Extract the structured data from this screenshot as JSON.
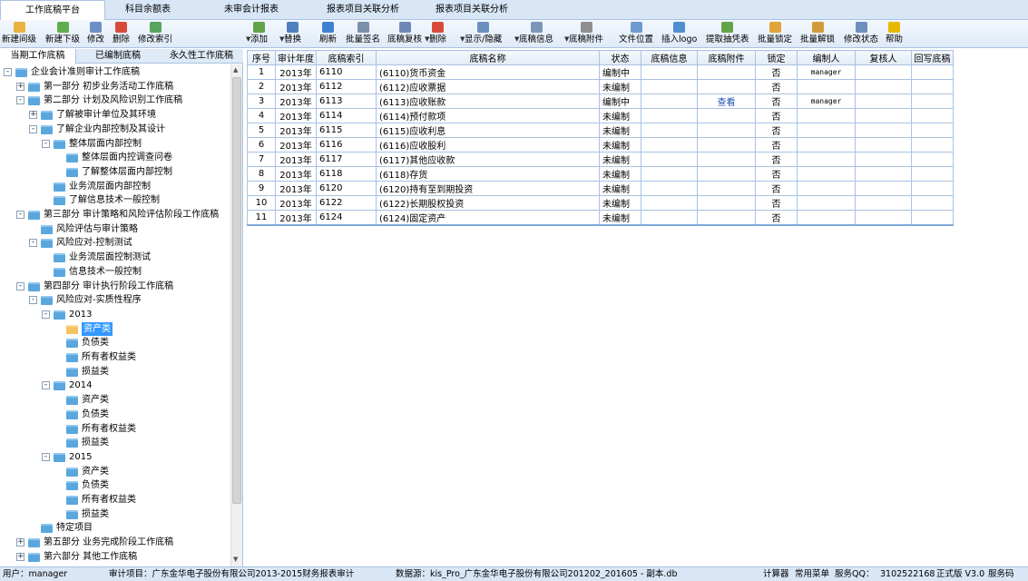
{
  "tabs": [
    "工作底稿平台",
    "科目余额表",
    "未审会计报表",
    "报表项目关联分析",
    "报表项目关联分析"
  ],
  "toolbar_left": [
    {
      "label": "新建间级",
      "icon": "folder-new-icon",
      "color": "#e9b33f"
    },
    {
      "label": "新建下级",
      "icon": "folder-child-icon",
      "color": "#5fae4e"
    },
    {
      "label": "修改",
      "icon": "edit-icon",
      "color": "#6d8fc4"
    },
    {
      "label": "删除",
      "icon": "delete-icon",
      "color": "#d84b3c"
    },
    {
      "label": "修改索引",
      "icon": "index-edit-icon",
      "color": "#55a55f"
    }
  ],
  "toolbar_right": [
    {
      "label": "添加",
      "icon": "add-icon",
      "color": "#62a347",
      "drop": true
    },
    {
      "label": "替换",
      "icon": "replace-icon",
      "color": "#4f7fbf",
      "drop": true
    },
    {
      "label": "刷新",
      "icon": "refresh-icon",
      "color": "#3f7fcf"
    },
    {
      "label": "批量签名",
      "icon": "batch-sign-icon",
      "color": "#7b8faa"
    },
    {
      "label": "底稿复核",
      "icon": "review-icon",
      "color": "#6e88b5"
    },
    {
      "label": "删除",
      "icon": "delete-icon",
      "color": "#d84b3c",
      "drop": true
    },
    {
      "label": "显示/隐藏",
      "icon": "show-hide-icon",
      "color": "#6b8fbf",
      "drop": true
    },
    {
      "label": "底稿信息",
      "icon": "info-icon",
      "color": "#7c96b8",
      "drop": true
    },
    {
      "label": "底稿附件",
      "icon": "attachment-icon",
      "color": "#8f8f8f",
      "drop": true
    },
    {
      "label": "文件位置",
      "icon": "file-location-icon",
      "color": "#6f9ad0"
    },
    {
      "label": "插入logo",
      "icon": "insert-logo-icon",
      "color": "#4f8fcf"
    },
    {
      "label": "提取抽凭表",
      "icon": "extract-icon",
      "color": "#62a347"
    },
    {
      "label": "批量锁定",
      "icon": "lock-icon",
      "color": "#e0a43a"
    },
    {
      "label": "批量解锁",
      "icon": "unlock-icon",
      "color": "#d39a3a"
    },
    {
      "label": "修改状态",
      "icon": "status-icon",
      "color": "#6f8fbf"
    },
    {
      "label": "帮助",
      "icon": "help-icon",
      "color": "#e6b800"
    }
  ],
  "left_tabs": [
    "当期工作底稿",
    "已编制底稿",
    "永久性工作底稿"
  ],
  "tree": [
    {
      "label": "企业会计准则审计工作底稿",
      "level": 0,
      "exp": "-"
    },
    {
      "label": "第一部分 初步业务活动工作底稿",
      "level": 1,
      "exp": "+"
    },
    {
      "label": "第二部分 计划及风险识别工作底稿",
      "level": 1,
      "exp": "-"
    },
    {
      "label": "了解被审计单位及其环境",
      "level": 2,
      "exp": "+"
    },
    {
      "label": "了解企业内部控制及其设计",
      "level": 2,
      "exp": "-"
    },
    {
      "label": "整体层面内部控制",
      "level": 3,
      "exp": "-"
    },
    {
      "label": "整体层面内控调查问卷",
      "level": 4,
      "exp": ""
    },
    {
      "label": "了解整体层面内部控制",
      "level": 4,
      "exp": ""
    },
    {
      "label": "业务流层面内部控制",
      "level": 3,
      "exp": ""
    },
    {
      "label": "了解信息技术一般控制",
      "level": 3,
      "exp": ""
    },
    {
      "label": "第三部分 审计策略和风险评估阶段工作底稿",
      "level": 1,
      "exp": "-"
    },
    {
      "label": "风险评估与审计策略",
      "level": 2,
      "exp": ""
    },
    {
      "label": "风险应对-控制测试",
      "level": 2,
      "exp": "-"
    },
    {
      "label": "业务流层面控制测试",
      "level": 3,
      "exp": ""
    },
    {
      "label": "信息技术一般控制",
      "level": 3,
      "exp": ""
    },
    {
      "label": "第四部分 审计执行阶段工作底稿",
      "level": 1,
      "exp": "-"
    },
    {
      "label": "风险应对-实质性程序",
      "level": 2,
      "exp": "-"
    },
    {
      "label": "2013",
      "level": 3,
      "exp": "-"
    },
    {
      "label": "资产类",
      "level": 4,
      "exp": "",
      "selected": true
    },
    {
      "label": "负债类",
      "level": 4,
      "exp": ""
    },
    {
      "label": "所有者权益类",
      "level": 4,
      "exp": ""
    },
    {
      "label": "损益类",
      "level": 4,
      "exp": ""
    },
    {
      "label": "2014",
      "level": 3,
      "exp": "-"
    },
    {
      "label": "资产类",
      "level": 4,
      "exp": ""
    },
    {
      "label": "负债类",
      "level": 4,
      "exp": ""
    },
    {
      "label": "所有者权益类",
      "level": 4,
      "exp": ""
    },
    {
      "label": "损益类",
      "level": 4,
      "exp": ""
    },
    {
      "label": "2015",
      "level": 3,
      "exp": "-"
    },
    {
      "label": "资产类",
      "level": 4,
      "exp": ""
    },
    {
      "label": "负债类",
      "level": 4,
      "exp": ""
    },
    {
      "label": "所有者权益类",
      "level": 4,
      "exp": ""
    },
    {
      "label": "损益类",
      "level": 4,
      "exp": ""
    },
    {
      "label": "特定项目",
      "level": 2,
      "exp": ""
    },
    {
      "label": "第五部分 业务完成阶段工作底稿",
      "level": 1,
      "exp": "+"
    },
    {
      "label": "第六部分 其他工作底稿",
      "level": 1,
      "exp": "+"
    }
  ],
  "grid": {
    "headers": [
      "序号",
      "审计年度",
      "底稿索引",
      "底稿名称",
      "状态",
      "底稿信息",
      "底稿附件",
      "锁定",
      "编制人",
      "复核人",
      "回写底稿"
    ],
    "rows": [
      [
        "1",
        "2013年",
        "6110",
        "(6110)货币资金",
        "编制中",
        "",
        "",
        "否",
        "manager",
        "",
        ""
      ],
      [
        "2",
        "2013年",
        "6112",
        "(6112)应收票据",
        "未编制",
        "",
        "",
        "否",
        "",
        "",
        ""
      ],
      [
        "3",
        "2013年",
        "6113",
        "(6113)应收账款",
        "编制中",
        "",
        "查看",
        "否",
        "manager",
        "",
        ""
      ],
      [
        "4",
        "2013年",
        "6114",
        "(6114)预付款项",
        "未编制",
        "",
        "",
        "否",
        "",
        "",
        ""
      ],
      [
        "5",
        "2013年",
        "6115",
        "(6115)应收利息",
        "未编制",
        "",
        "",
        "否",
        "",
        "",
        ""
      ],
      [
        "6",
        "2013年",
        "6116",
        "(6116)应收股利",
        "未编制",
        "",
        "",
        "否",
        "",
        "",
        ""
      ],
      [
        "7",
        "2013年",
        "6117",
        "(6117)其他应收款",
        "未编制",
        "",
        "",
        "否",
        "",
        "",
        ""
      ],
      [
        "8",
        "2013年",
        "6118",
        "(6118)存货",
        "未编制",
        "",
        "",
        "否",
        "",
        "",
        ""
      ],
      [
        "9",
        "2013年",
        "6120",
        "(6120)持有至到期投资",
        "未编制",
        "",
        "",
        "否",
        "",
        "",
        ""
      ],
      [
        "10",
        "2013年",
        "6122",
        "(6122)长期股权投资",
        "未编制",
        "",
        "",
        "否",
        "",
        "",
        ""
      ],
      [
        "11",
        "2013年",
        "6124",
        "(6124)固定资产",
        "未编制",
        "",
        "",
        "否",
        "",
        "",
        ""
      ]
    ]
  },
  "status": {
    "user": "用户：manager",
    "project": "审计项目：广东金华电子股份有限公司2013-2015财务报表审计",
    "datasource": "数据源：kis_Pro_广东金华电子股份有限公司201202_201605 - 副本.db",
    "calc": "计算器",
    "menu": "常用菜单",
    "qq": "服务QQ：",
    "qq_number": "3102522168",
    "version": "正式版 V3.0",
    "service": "服务码"
  }
}
